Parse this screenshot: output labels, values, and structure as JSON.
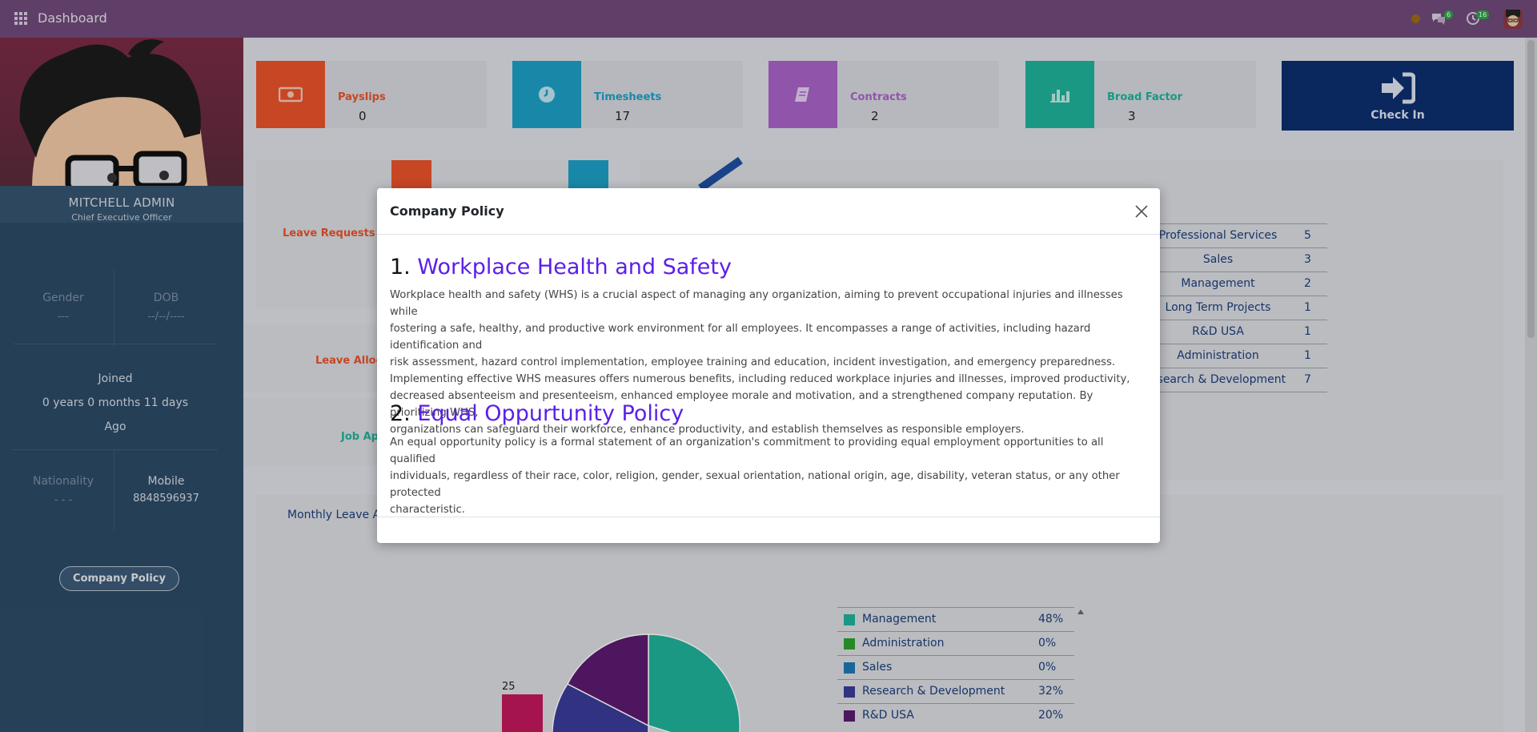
{
  "topbar": {
    "app_title": "Dashboard",
    "chat_count": "6",
    "activity_count": "16"
  },
  "profile": {
    "name": "MITCHELL ADMIN",
    "role": "Chief Executive Officer"
  },
  "info": {
    "gender_label": "Gender",
    "gender_value": "---",
    "dob_label": "DOB",
    "dob_value": "--/--/----",
    "joined_label": "Joined",
    "joined_value": "0 years 0 months 11 days",
    "joined_suffix": "Ago",
    "nationality_label": "Nationality",
    "nationality_value": "- - -",
    "mobile_label": "Mobile",
    "mobile_value": "8848596937"
  },
  "company_policy_button": "Company Policy",
  "cards": [
    {
      "label": "Payslips",
      "value": "0",
      "color": "#e8522a"
    },
    {
      "label": "Timesheets",
      "value": "17",
      "color": "#1e9fc4"
    },
    {
      "label": "Contracts",
      "value": "2",
      "color": "#a862c8"
    },
    {
      "label": "Broad Factor",
      "value": "3",
      "color": "#1fb29a"
    }
  ],
  "check_in_label": "Check In",
  "side_links": {
    "leave_requests": "Leave Requests",
    "leave_allocations": "Leave Alloc",
    "job_applications": "Job Ap"
  },
  "departments": [
    {
      "name": "Professional Services",
      "count": "5"
    },
    {
      "name": "Sales",
      "count": "3"
    },
    {
      "name": "Management",
      "count": "2"
    },
    {
      "name": "Long Term Projects",
      "count": "1"
    },
    {
      "name": "R&D USA",
      "count": "1"
    },
    {
      "name": "Administration",
      "count": "1"
    },
    {
      "name": "esearch & Development",
      "count": "7"
    }
  ],
  "monthly_leave_label": "Monthly Leave A",
  "bar_value_label": "25",
  "legend": [
    {
      "name": "Management",
      "pct": "48%",
      "color": "#1fb29a"
    },
    {
      "name": "Administration",
      "pct": "0%",
      "color": "#2ca02c"
    },
    {
      "name": "Sales",
      "pct": "0%",
      "color": "#1f77b4"
    },
    {
      "name": "Research & Development",
      "pct": "32%",
      "color": "#3b3b98"
    },
    {
      "name": "R&D USA",
      "pct": "20%",
      "color": "#5b1a6e"
    }
  ],
  "modal": {
    "title": "Company Policy",
    "sections": [
      {
        "num": "1.",
        "title": "Workplace Health and Safety",
        "lines": [
          "Workplace health and safety (WHS) is a crucial aspect of managing any organization, aiming to prevent occupational injuries and illnesses while",
          "fostering a safe, healthy, and productive work environment for all employees. It encompasses a range of activities, including hazard identification and",
          "risk assessment, hazard control implementation, employee training and education, incident investigation, and emergency preparedness.",
          "Implementing effective WHS measures offers numerous benefits, including reduced workplace injuries and illnesses, improved productivity,",
          "decreased absenteeism and presenteeism, enhanced employee morale and motivation, and a strengthened company reputation. By prioritizing WHS,",
          "organizations can safeguard their workforce, enhance productivity, and establish themselves as responsible employers."
        ]
      },
      {
        "num": "2.",
        "title": "Equal Oppurtunity Policy",
        "lines": [
          "An equal opportunity policy is a formal statement of an organization's commitment to providing equal employment opportunities to all qualified",
          "individuals, regardless of their race, color, religion, gender, sexual orientation, national origin, age, disability, veteran status, or any other protected",
          "characteristic."
        ]
      }
    ]
  }
}
